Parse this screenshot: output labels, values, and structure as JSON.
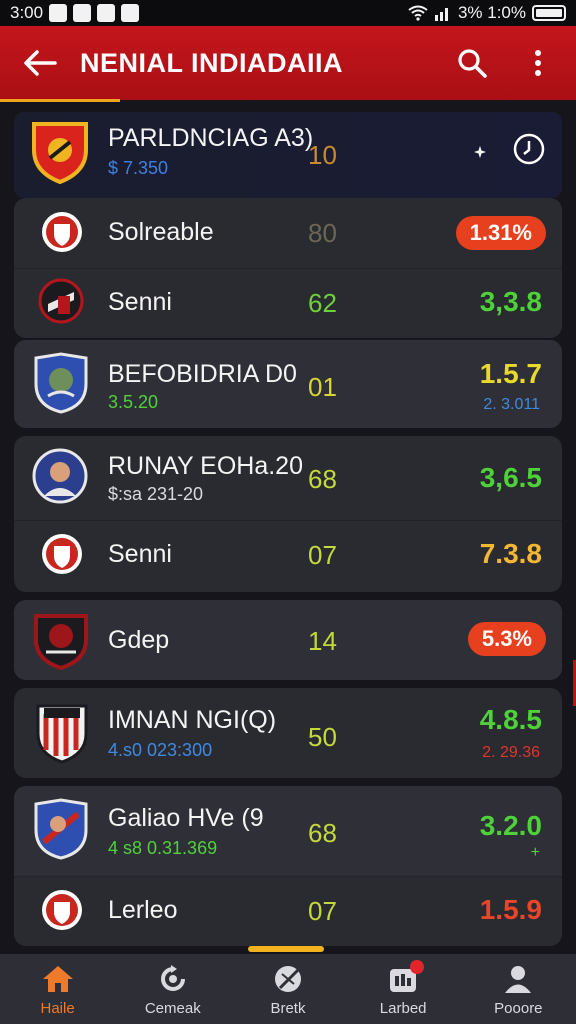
{
  "status_bar": {
    "time": "3:00",
    "right_text": "3%  1:0%"
  },
  "app_bar": {
    "title": "NENIAL INDIADAIIA"
  },
  "header": {
    "name": "PARLDNCIAG A3)",
    "sub": "$ 7.350",
    "mid": "10"
  },
  "cards": [
    {
      "rows": [
        {
          "name": "Solreable",
          "mid": "80",
          "mid_color": "#6b6753",
          "pill": "1.31%",
          "logo_color": "#c8271f"
        },
        {
          "name": "Senni",
          "mid": "62",
          "mid_color": "#6dd13b",
          "value": "3,3.8",
          "value_color": "#4fd13a",
          "logo_color": "#b3161b"
        }
      ]
    },
    {
      "rows": [
        {
          "name": "BEFOBIDRIA D0",
          "sub": "3.5.20",
          "sub_color": "#4fd13a",
          "mid": "01",
          "mid_color": "#d8d630",
          "value": "1.5.7",
          "value_color": "#e8d92c",
          "value2": "2. 3.011",
          "value2_color": "#3f8ae0",
          "logo_color": "#2f4fb0"
        }
      ]
    },
    {
      "rows": [
        {
          "name": "RUNAY EOHa.20",
          "sub": "$:sa 231-20",
          "sub_color": "#d9d9df",
          "mid": "68",
          "mid_color": "#c4d93a",
          "value": "3,6.5",
          "value_color": "#4fd13a",
          "logo_color": "#2b3f8e"
        },
        {
          "name": "Senni",
          "mid": "07",
          "mid_color": "#c4d93a",
          "value": "7.3.8",
          "value_color": "#f2b833",
          "logo_color": "#c8271f"
        }
      ]
    },
    {
      "rows": [
        {
          "name": "Gdep",
          "mid": "14",
          "mid_color": "#c4d93a",
          "pill": "5.3%",
          "logo_color": "#9c161a"
        }
      ]
    },
    {
      "rows": [
        {
          "name": "IMNAN NGI(Q)",
          "sub": "4.s0 023:300",
          "sub_color": "#3f8ae0",
          "mid": "50",
          "mid_color": "#c4d93a",
          "value": "4.8.5",
          "value_color": "#4fd13a",
          "value2": "2. 29.36",
          "value2_color": "#e0362a",
          "logo_color": "#c8271f"
        }
      ]
    },
    {
      "rows": [
        {
          "name": "Galiao HVe (9",
          "sub": "4 s8 0.31.369",
          "sub_color": "#4fd13a",
          "mid": "68",
          "mid_color": "#c4d93a",
          "value": "3.2.0",
          "value_color": "#4fd13a",
          "value2": "+",
          "value2_color": "#4fd13a",
          "logo_color": "#2f4fb0"
        },
        {
          "name": "Lerleo",
          "mid": "07",
          "mid_color": "#c4d93a",
          "value": "1.5.9",
          "value_color": "#e8452a",
          "logo_color": "#c8271f"
        }
      ]
    }
  ],
  "bottom_nav": [
    {
      "label": "Haile",
      "icon": "home-icon",
      "active": true
    },
    {
      "label": "Cemeak",
      "icon": "refresh-icon",
      "active": false
    },
    {
      "label": "Bretk",
      "icon": "ball-icon",
      "active": false
    },
    {
      "label": "Larbed",
      "icon": "calendar-icon",
      "active": false
    },
    {
      "label": "Pooore",
      "icon": "profile-icon",
      "active": false
    }
  ]
}
